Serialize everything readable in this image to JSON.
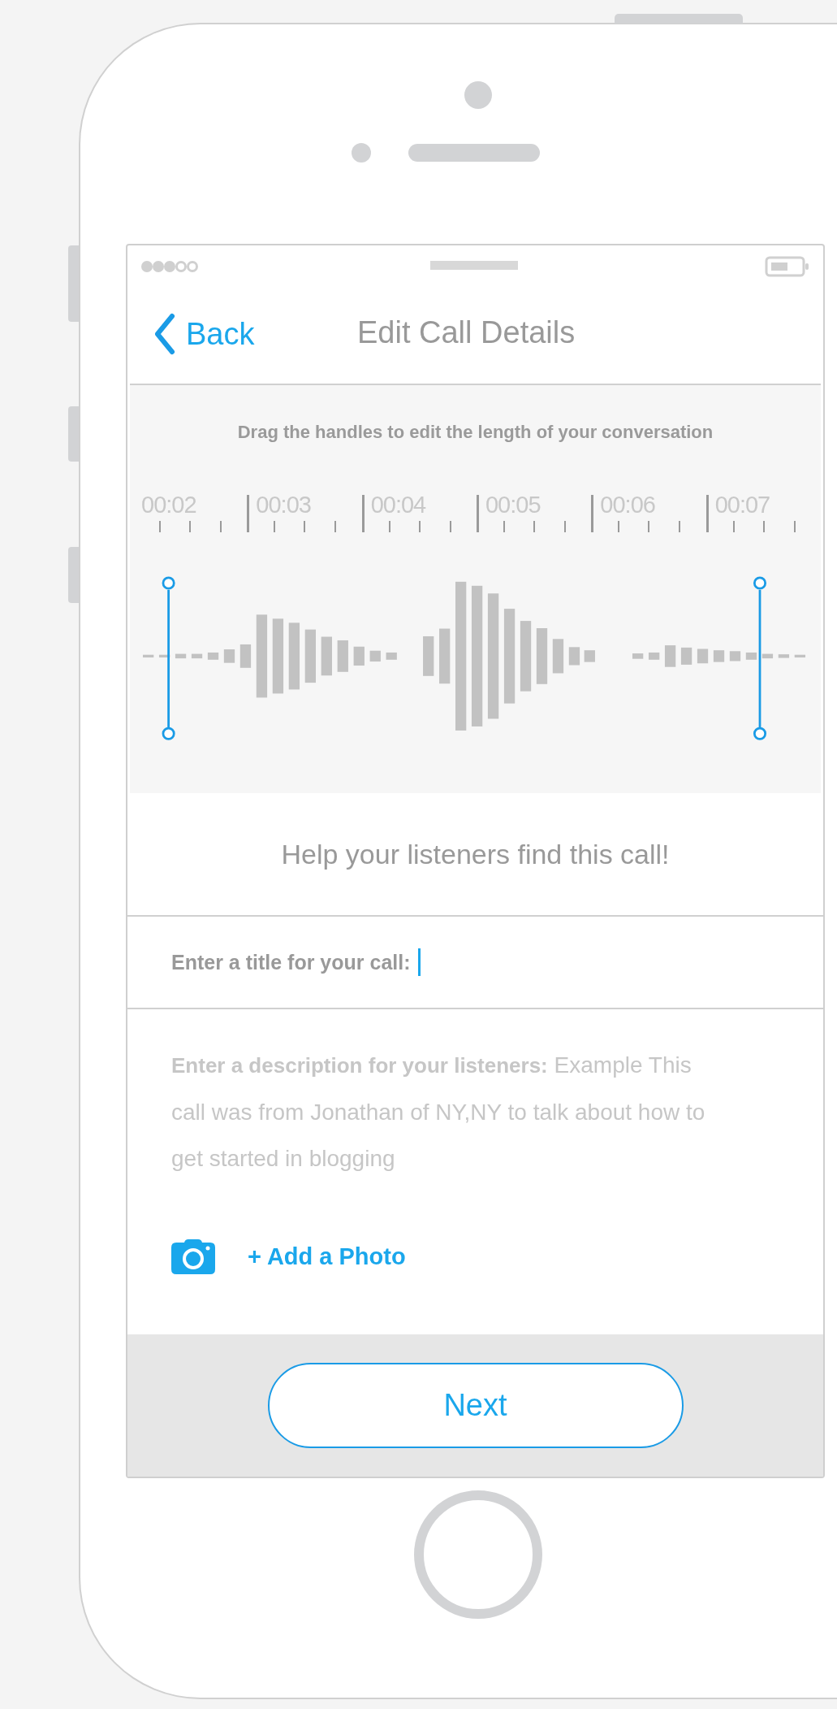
{
  "nav": {
    "back_label": "Back",
    "title": "Edit Call Details"
  },
  "trimmer": {
    "instruction": "Drag the handles to edit the length of your conversation",
    "time_labels": [
      "00:02",
      "00:03",
      "00:04",
      "00:05",
      "00:06",
      "00:07"
    ]
  },
  "heading": "Help your listeners find this call!",
  "title_field": {
    "label": "Enter a title for your call:",
    "focused": true
  },
  "description_field": {
    "label": "Enter a description for your listeners:",
    "placeholder": "Example This call was from Jonathan of NY,NY to talk about how to get started in blogging"
  },
  "add_photo": "+ Add a Photo",
  "next_button": "Next"
}
